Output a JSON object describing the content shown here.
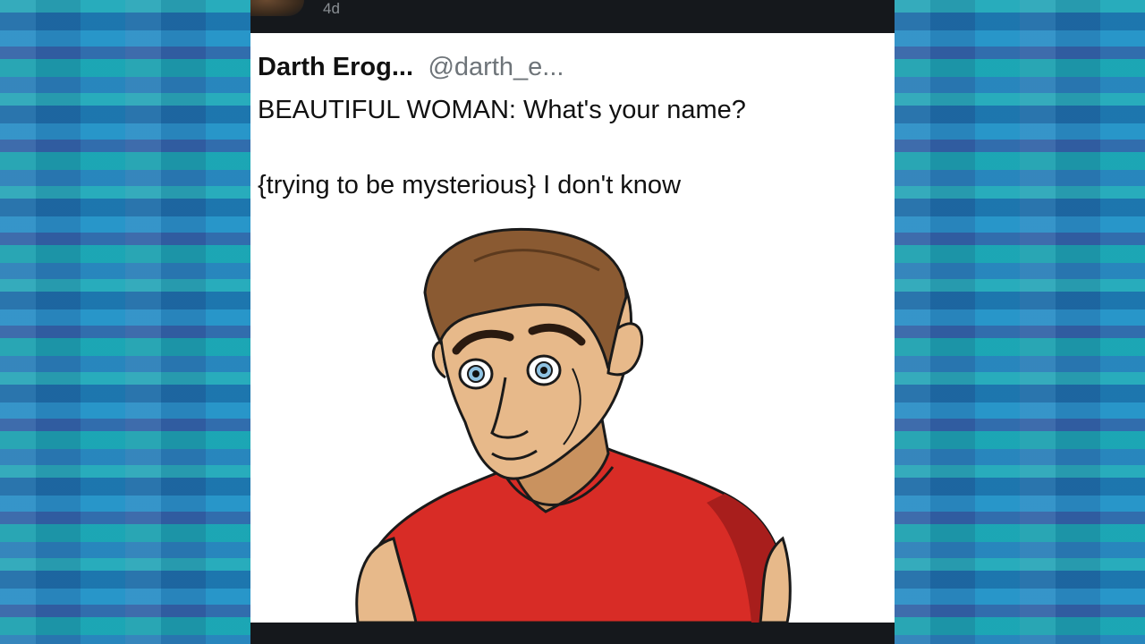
{
  "tweet": {
    "display_name": "Darth Erog...",
    "handle": "@darth_e...",
    "time": "4d",
    "text_line1": "BEAUTIFUL WOMAN: What's your name?",
    "text_line2": "{trying to be mysterious} I don't know"
  },
  "image": {
    "subject": "cartoon-man-red-shirt"
  },
  "colors": {
    "page_bg": "#1d7fa8",
    "bar": "#15181c",
    "card": "#ffffff",
    "shirt": "#d82c26",
    "skin": "#e7b98a",
    "hair": "#8a5a32"
  }
}
